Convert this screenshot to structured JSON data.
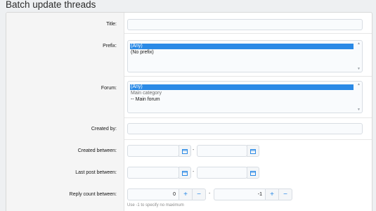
{
  "page": {
    "title": "Batch update threads"
  },
  "form": {
    "title_label": "Title:",
    "prefix_label": "Prefix:",
    "prefix_options": [
      "(Any)",
      "(No prefix)"
    ],
    "forum_label": "Forum:",
    "forum_options": [
      "(Any)",
      "Main category",
      "-- Main forum"
    ],
    "created_by_label": "Created by:",
    "created_between_label": "Created between:",
    "last_post_between_label": "Last post between:",
    "reply_count_label": "Reply count between:",
    "reply_min_value": "0",
    "reply_max_value": "-1",
    "reply_hint": "Use -1 to specify no maximum",
    "range_separator": "-",
    "plus": "+",
    "minus": "−"
  },
  "colors": {
    "accent": "#2b8ae6",
    "selection": "#2b8ae6"
  },
  "icons": {
    "calendar": "calendar-icon",
    "scroll_up": "scroll-up-icon",
    "scroll_down": "scroll-down-icon"
  }
}
